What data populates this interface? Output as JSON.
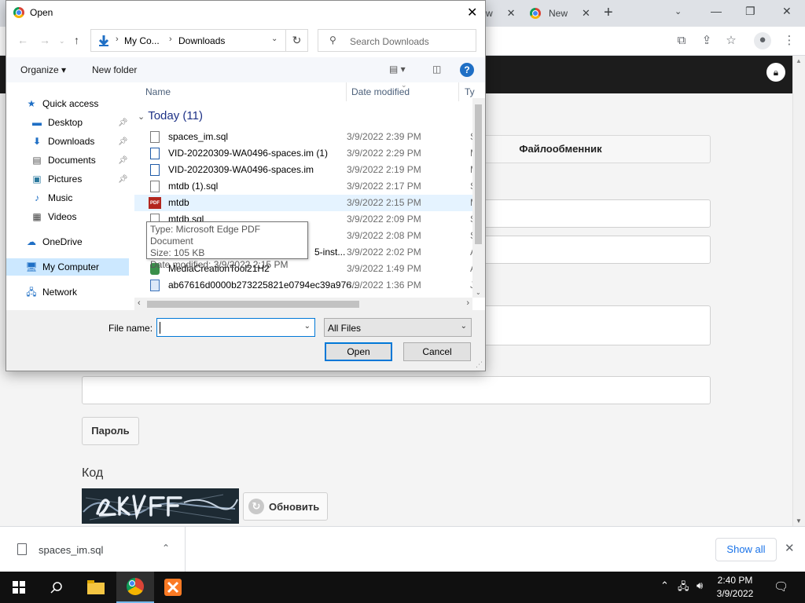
{
  "browser": {
    "tabs": [
      {
        "label": "w",
        "close": "✕"
      },
      {
        "label": "New",
        "close": "✕"
      }
    ],
    "new_tab": "+",
    "window_controls": {
      "minimize": "—",
      "restore": "❐",
      "close": "✕"
    }
  },
  "page": {
    "fileshare_button": "Файлообменник",
    "password_button": "Пароль",
    "code_label": "Код",
    "refresh_button": "Обновить"
  },
  "dialog": {
    "title": "Open",
    "breadcrumb": {
      "part1": "My Co...",
      "part2": "Downloads"
    },
    "search_placeholder": "Search Downloads",
    "organize": "Organize ▾",
    "new_folder": "New folder",
    "help": "?",
    "columns": {
      "name": "Name",
      "date": "Date modified",
      "type": "Ty"
    },
    "group_label": "Today (11)",
    "nav": [
      {
        "label": "Quick access",
        "icon": "star-icon",
        "pinned": false
      },
      {
        "label": "Desktop",
        "icon": "desktop-icon",
        "pinned": true
      },
      {
        "label": "Downloads",
        "icon": "download-icon",
        "pinned": true
      },
      {
        "label": "Documents",
        "icon": "documents-icon",
        "pinned": true
      },
      {
        "label": "Pictures",
        "icon": "pictures-icon",
        "pinned": true
      },
      {
        "label": "Music",
        "icon": "music-icon",
        "pinned": false
      },
      {
        "label": "Videos",
        "icon": "videos-icon",
        "pinned": false
      },
      {
        "label": "OneDrive",
        "icon": "cloud-icon",
        "pinned": false
      },
      {
        "label": "My Computer",
        "icon": "computer-icon",
        "pinned": false
      },
      {
        "label": "Network",
        "icon": "network-icon",
        "pinned": false
      }
    ],
    "files": [
      {
        "name": "spaces_im.sql",
        "date": "3/9/2022 2:39 PM",
        "type": "SC",
        "icon": "file"
      },
      {
        "name": "VID-20220309-WA0496-spaces.im (1)",
        "date": "3/9/2022 2:29 PM",
        "type": "M",
        "icon": "vid"
      },
      {
        "name": "VID-20220309-WA0496-spaces.im",
        "date": "3/9/2022 2:19 PM",
        "type": "M",
        "icon": "vid"
      },
      {
        "name": "mtdb (1).sql",
        "date": "3/9/2022 2:17 PM",
        "type": "SC",
        "icon": "file"
      },
      {
        "name": "mtdb",
        "date": "3/9/2022 2:15 PM",
        "type": "M",
        "icon": "pdf"
      },
      {
        "name": "mtdb.sql",
        "date": "3/9/2022 2:09 PM",
        "type": "SC",
        "icon": "file"
      },
      {
        "name": "",
        "date": "3/9/2022 2:08 PM",
        "type": "SC",
        "icon": "file"
      },
      {
        "name": "5-inst...",
        "date": "3/9/2022 2:02 PM",
        "type": "Ap",
        "icon": "exe"
      },
      {
        "name": "MediaCreationTool21H2",
        "date": "3/9/2022 1:49 PM",
        "type": "Ap",
        "icon": "exe"
      },
      {
        "name": "ab67616d0000b273225821e0794ec39a976...",
        "date": "3/9/2022 1:36 PM",
        "type": "JF",
        "icon": "img"
      }
    ],
    "tooltip": {
      "type": "Type: Microsoft Edge PDF Document",
      "size": "Size: 105 KB",
      "modified": "Date modified: 3/9/2022 2:15 PM"
    },
    "file_name_label": "File name:",
    "file_name_value": "",
    "filter": "All Files",
    "open_button": "Open",
    "cancel_button": "Cancel"
  },
  "downloads": {
    "item": "spaces_im.sql",
    "show_all": "Show all"
  },
  "taskbar": {
    "time": "2:40 PM",
    "date": "3/9/2022"
  }
}
